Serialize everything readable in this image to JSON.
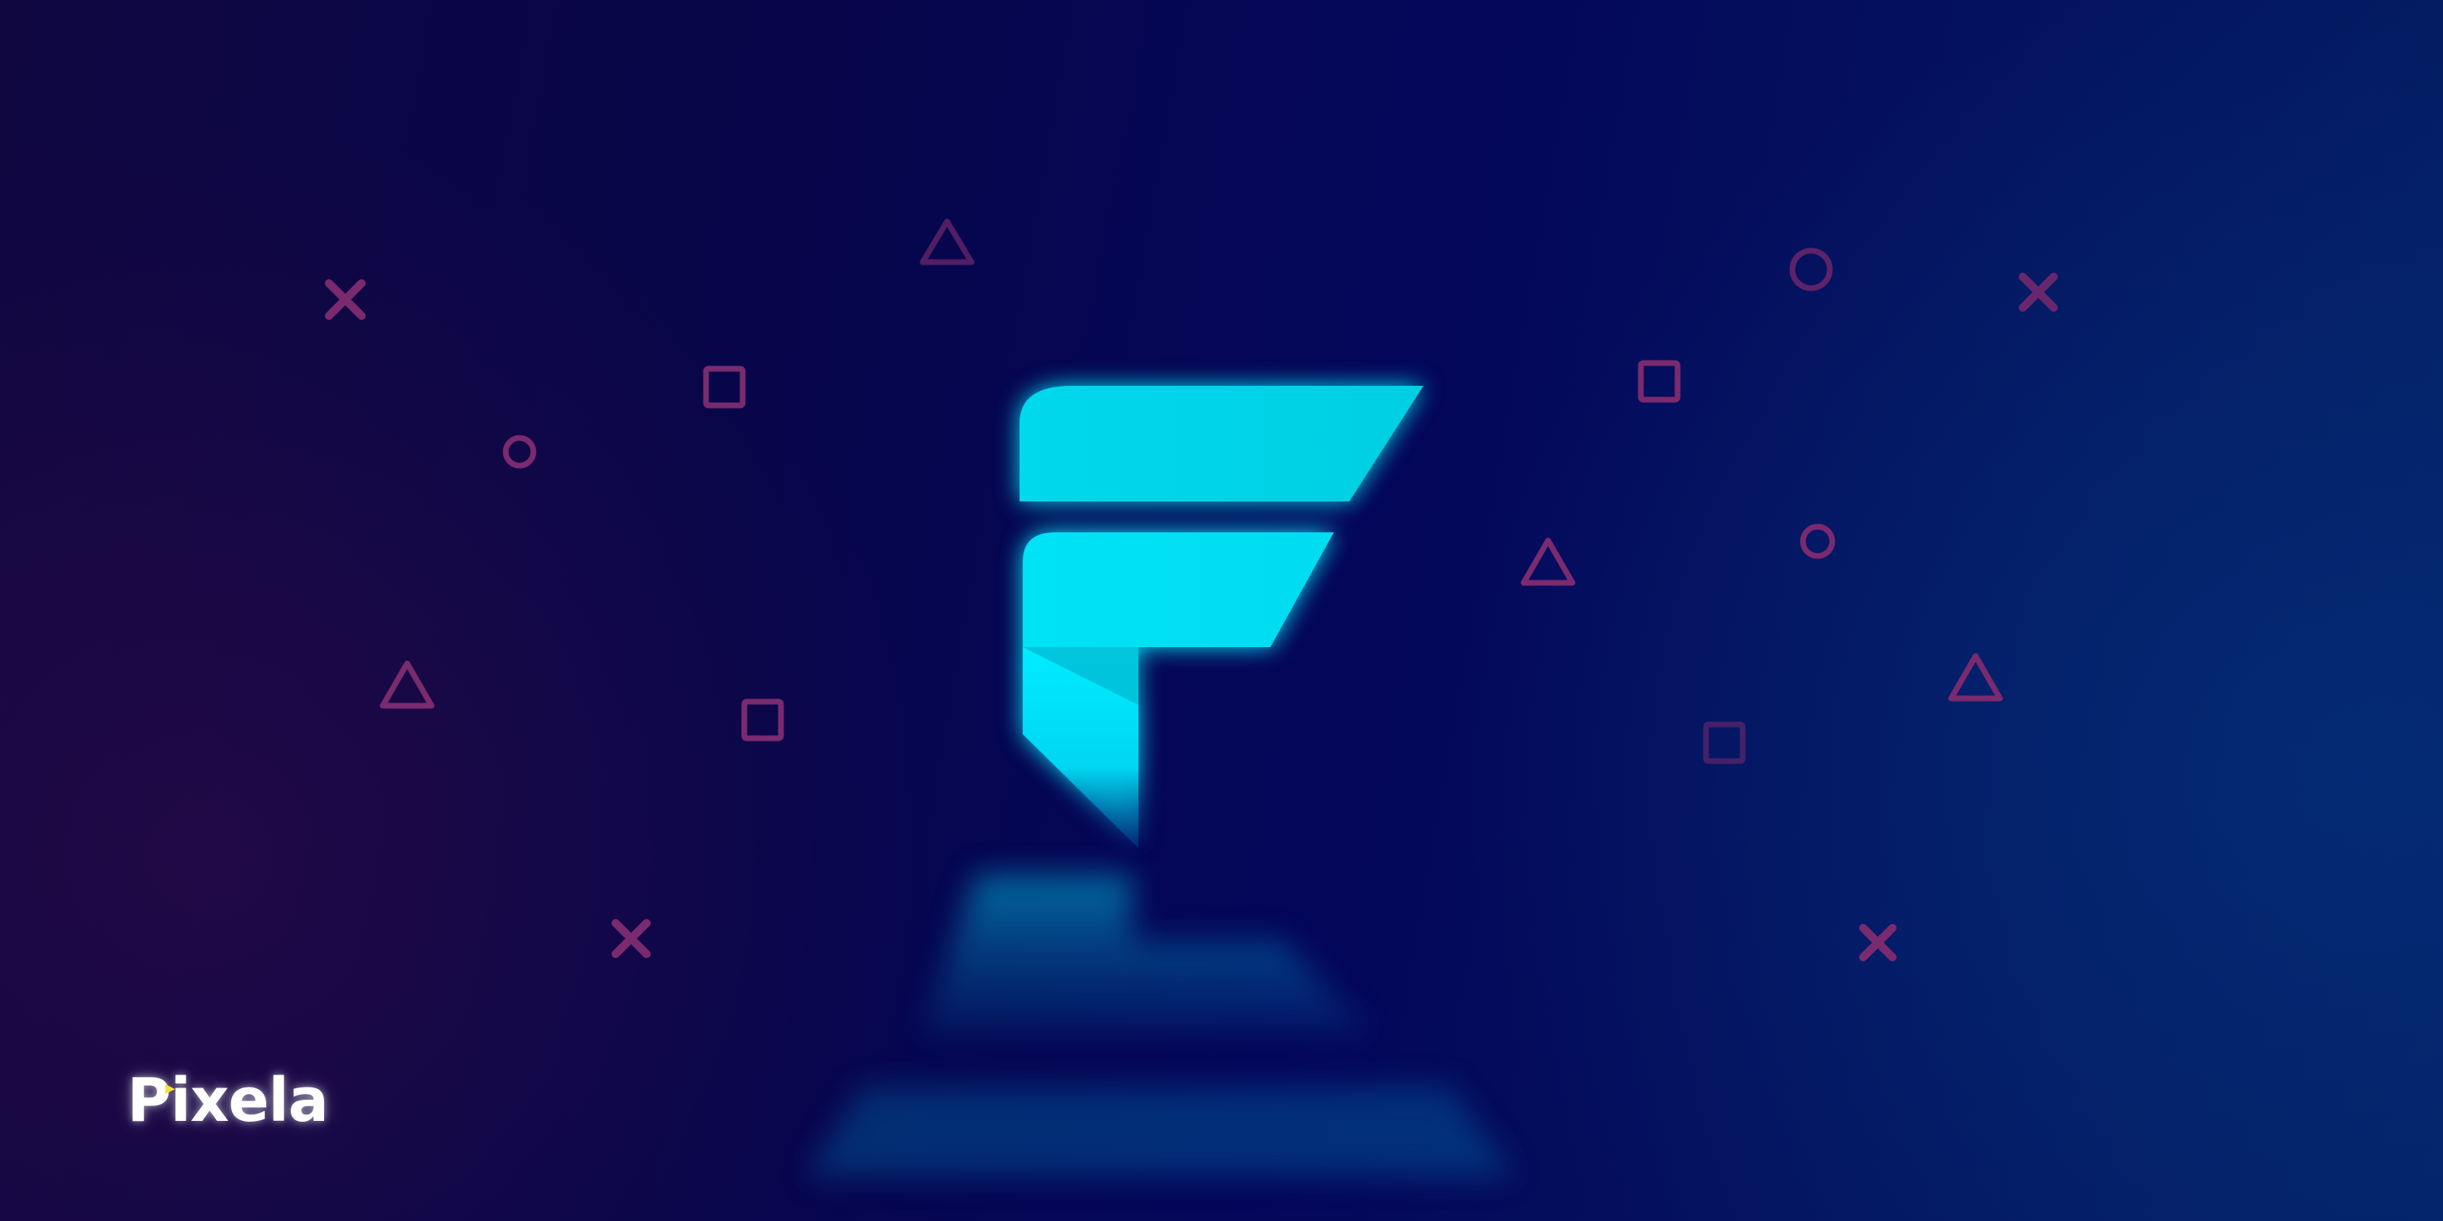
{
  "brand": {
    "name": "Pixela",
    "accent_color": "#f5e23a"
  },
  "logo": {
    "icon": "stylized-letter-f-icon",
    "color": "#00e5f5"
  },
  "background": {
    "colors": [
      "#0f0640",
      "#06064a",
      "#032063"
    ],
    "decoration_color": "#7a2a6e",
    "decorations": [
      "cross-icon",
      "circle-icon",
      "square-icon",
      "triangle-icon"
    ]
  }
}
